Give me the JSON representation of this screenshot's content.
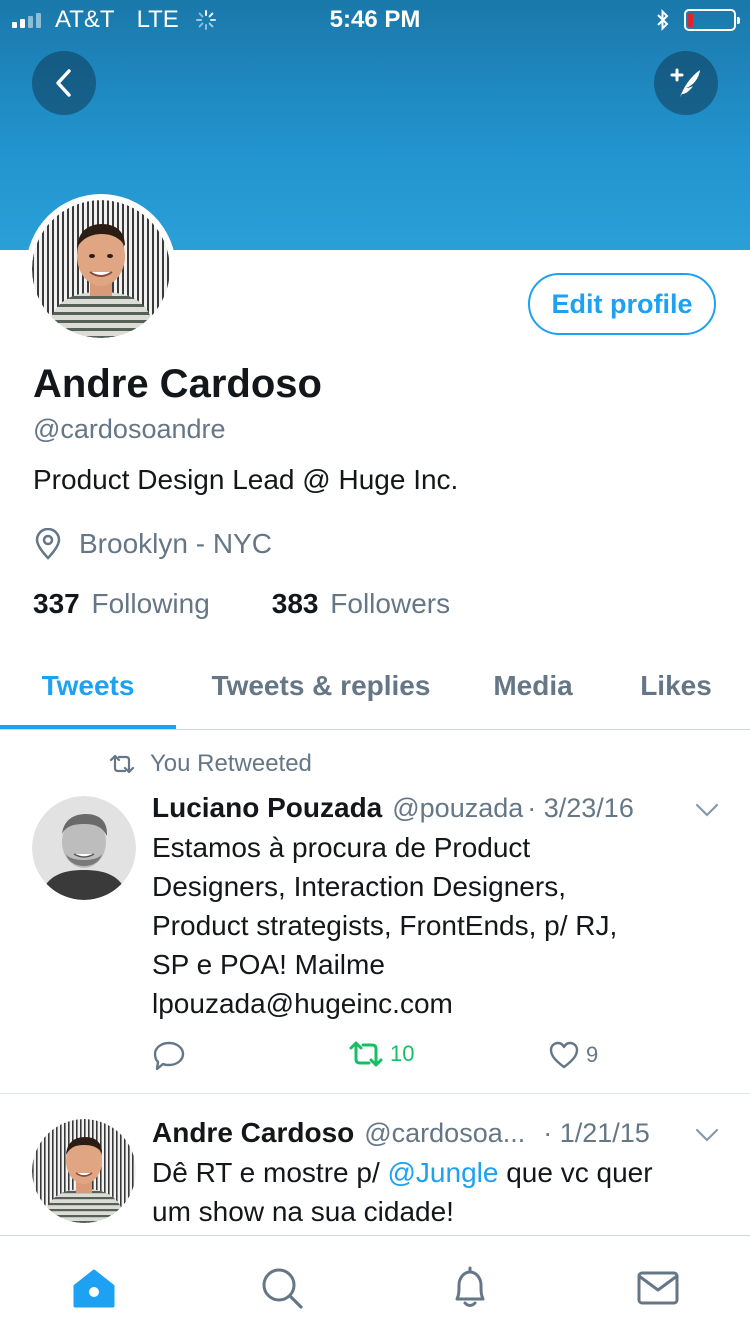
{
  "status_bar": {
    "carrier": "AT&T",
    "network": "LTE",
    "time": "5:46 PM"
  },
  "profile": {
    "name": "Andre Cardoso",
    "handle": "@cardosoandre",
    "bio": "Product Design Lead @ Huge Inc.",
    "location": "Brooklyn - NYC",
    "following_count": "337",
    "following_label": "Following",
    "followers_count": "383",
    "followers_label": "Followers",
    "edit_label": "Edit profile"
  },
  "tabs": [
    {
      "label": "Tweets",
      "active": true
    },
    {
      "label": "Tweets & replies",
      "active": false
    },
    {
      "label": "Media",
      "active": false
    },
    {
      "label": "Likes",
      "active": false
    }
  ],
  "tweets": [
    {
      "retweet_note": "You Retweeted",
      "author": "Luciano Pouzada",
      "handle": "@pouzada",
      "date": "· 3/23/16",
      "lines": [
        "Estamos à procura de Product",
        "Designers, Interaction Designers,",
        "Product strategists, FrontEnds, p/ RJ,",
        "SP e POA! Mailme",
        "lpouzada@hugeinc.com"
      ],
      "retweets": "10",
      "likes": "9"
    },
    {
      "author": "Andre Cardoso",
      "handle": "@cardosoa...",
      "date": "· 1/21/15",
      "text_before": "Dê RT e mostre p/ ",
      "mention": "@Jungle",
      "text_after": " que vc quer",
      "line2": "um show na sua cidade!"
    }
  ],
  "colors": {
    "accent": "#1da1f2",
    "retweet": "#17bf63",
    "muted": "#657786",
    "banner": "#2294cf"
  },
  "icons": {
    "back": "chevron-left-icon",
    "compose": "compose-tweet-icon",
    "location": "location-pin-icon",
    "retweet": "retweet-icon",
    "reply": "reply-icon",
    "like": "heart-icon",
    "home": "home-icon",
    "search": "search-icon",
    "notifications": "bell-icon",
    "messages": "mail-icon"
  }
}
